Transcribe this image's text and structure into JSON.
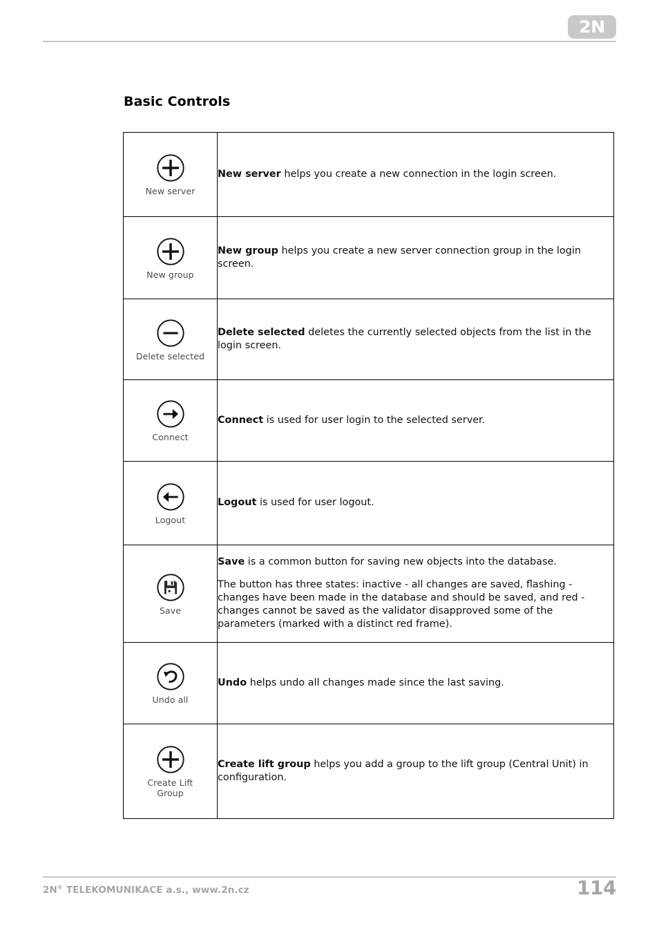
{
  "header": {
    "logo_text": "2N",
    "logo_color": "#c9c9c9",
    "rule_color": "#c6c6c6"
  },
  "section": {
    "title": "Basic Controls"
  },
  "table": {
    "rows": [
      {
        "icon": "plus-circle-icon",
        "icon_label": "New server",
        "term": "New server",
        "description": " helps you create a new connection in the login screen.",
        "paragraphs": []
      },
      {
        "icon": "plus-circle-icon",
        "icon_label": "New group",
        "term": "New group",
        "description": " helps you create a new server connection group in the login screen.",
        "paragraphs": []
      },
      {
        "icon": "minus-circle-icon",
        "icon_label": "Delete selected",
        "term": "Delete selected",
        "description": " deletes the currently selected objects from the list in the login screen.",
        "paragraphs": []
      },
      {
        "icon": "arrow-right-circle-icon",
        "icon_label": "Connect",
        "term": "Connect",
        "description": " is used for user login to the selected server.",
        "paragraphs": []
      },
      {
        "icon": "arrow-left-circle-icon",
        "icon_label": "Logout",
        "term": "Logout",
        "description": " is used for user logout.",
        "paragraphs": []
      },
      {
        "icon": "floppy-disk-circle-icon",
        "icon_label": "Save",
        "term": "Save",
        "description": " is a common button for saving new objects into the database.",
        "paragraphs": [
          "The button has three states: inactive - all changes are saved, flashing - changes have been made in the database and should be saved, and red - changes cannot be saved as the validator disapproved some of the parameters (marked with a distinct red frame)."
        ]
      },
      {
        "icon": "undo-arrow-circle-icon",
        "icon_label": "Undo all",
        "term": "Undo",
        "description": " helps undo all changes made since the last saving.",
        "paragraphs": []
      },
      {
        "icon": "plus-circle-icon",
        "icon_label_line1": "Create Lift",
        "icon_label_line2": "Group",
        "term": "Create lift group",
        "description": " helps you add a group to the lift group (Central Unit) in configuration.",
        "paragraphs": []
      }
    ]
  },
  "footer": {
    "company_prefix": "2N",
    "company_mark": "®",
    "company_rest": " TELEKOMUNIKACE a.s., www.2n.cz",
    "page_number": "114",
    "text_color": "#a6a6a6"
  }
}
